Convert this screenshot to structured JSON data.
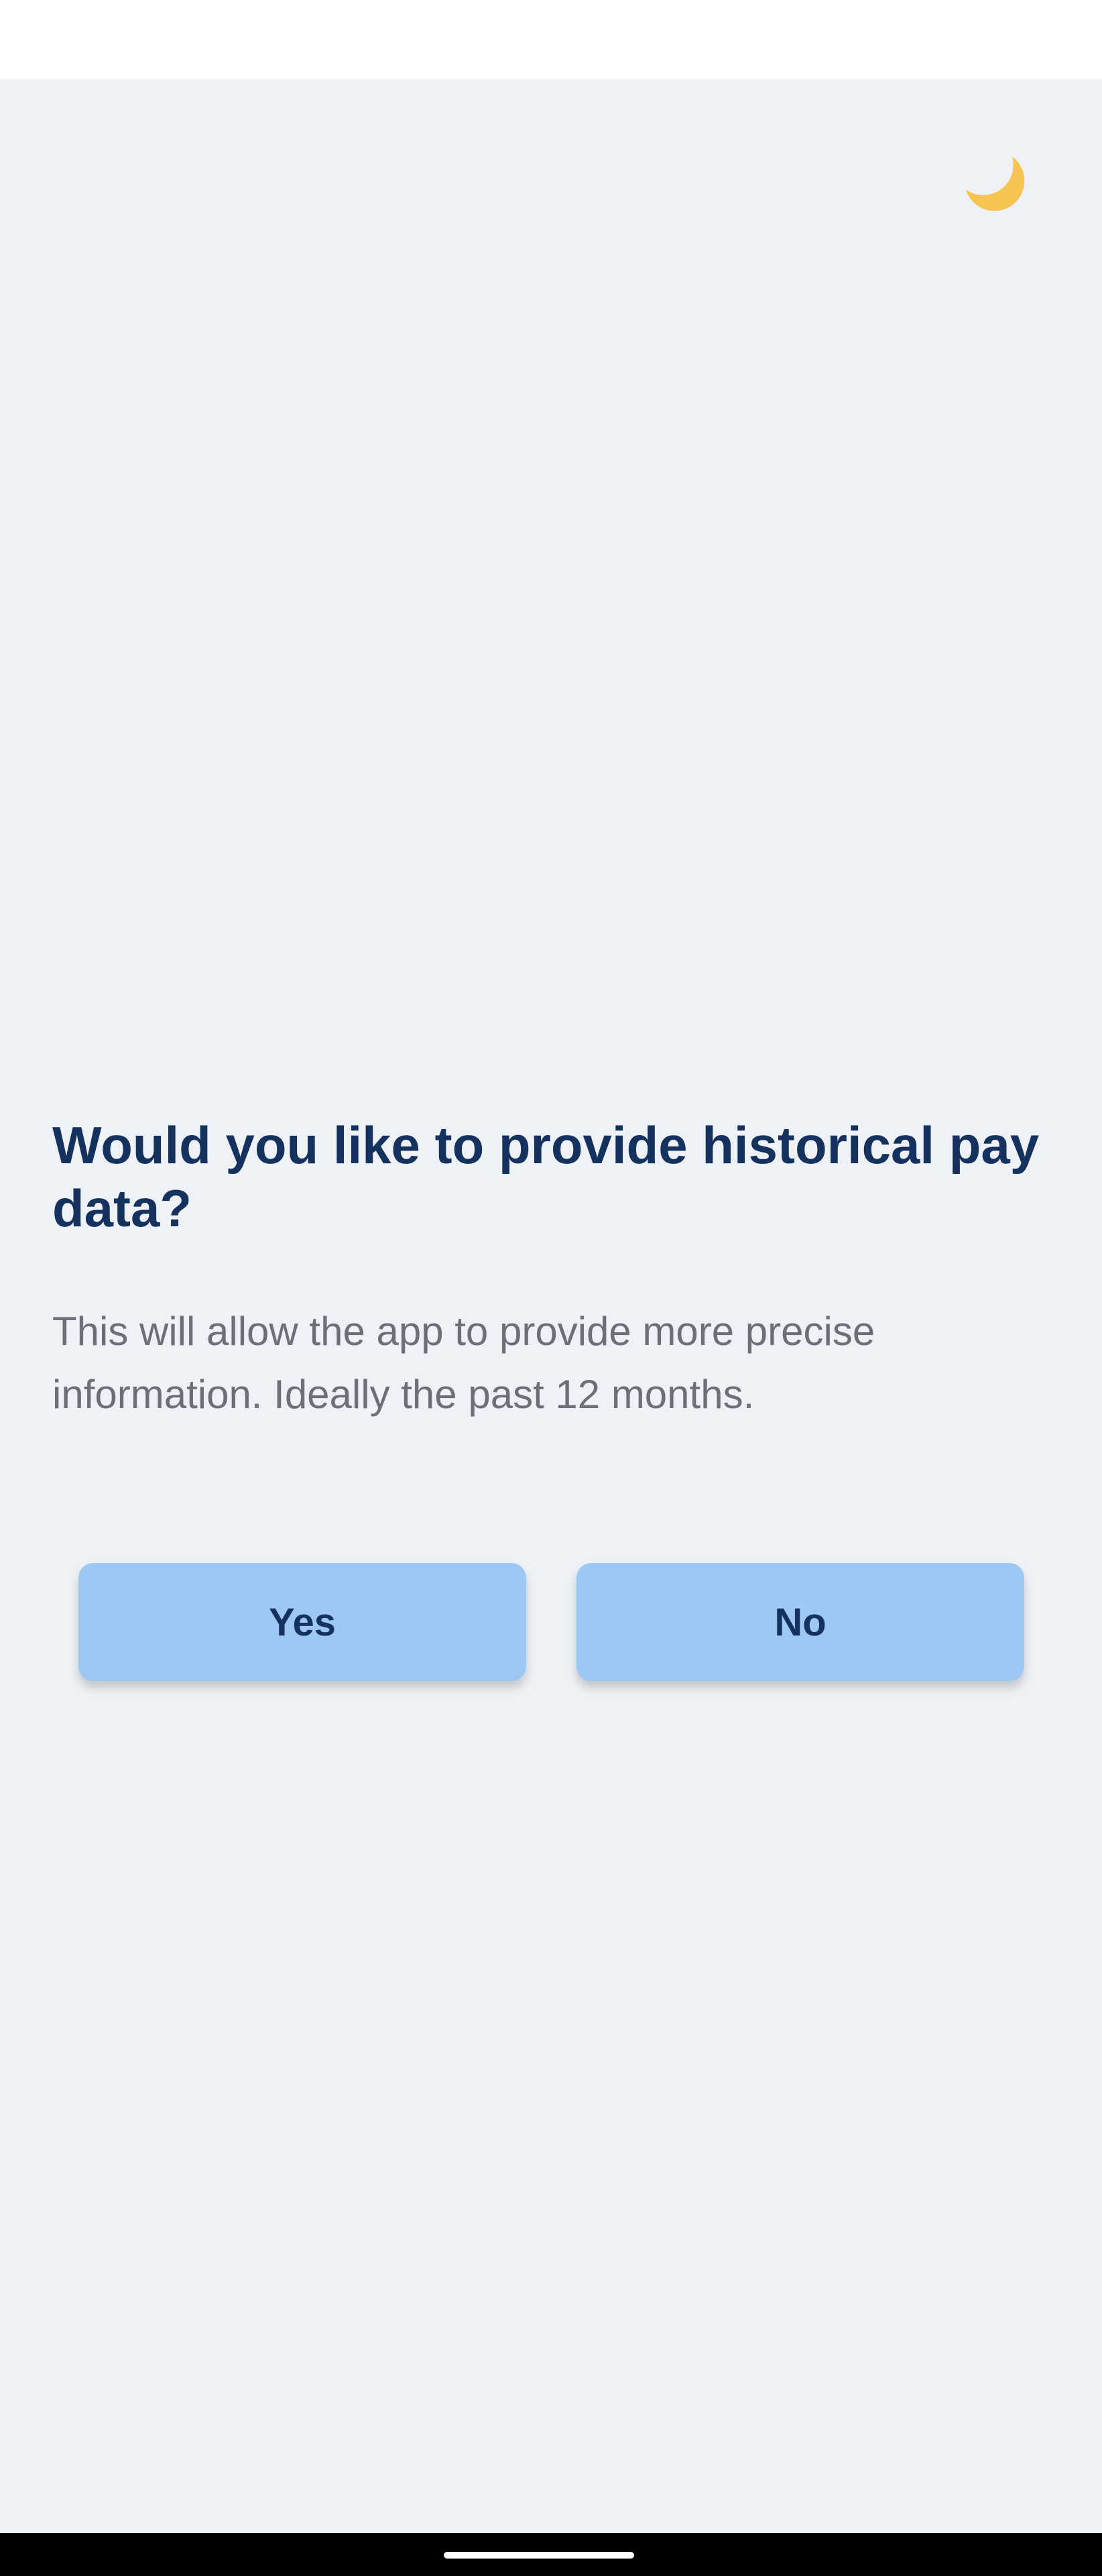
{
  "header": {
    "theme_toggle_icon": "crescent-moon-icon",
    "moon_color": "#f5c451"
  },
  "prompt": {
    "title": "Would you like to provide historical pay data?",
    "description": "This will allow the app to provide more precise information. Ideally the past 12 months."
  },
  "actions": {
    "yes_label": "Yes",
    "no_label": "No"
  },
  "colors": {
    "background": "#eef2f6",
    "title": "#15325f",
    "description": "#6b6f76",
    "button": "#9dc8f3",
    "button_text": "#15325f"
  }
}
